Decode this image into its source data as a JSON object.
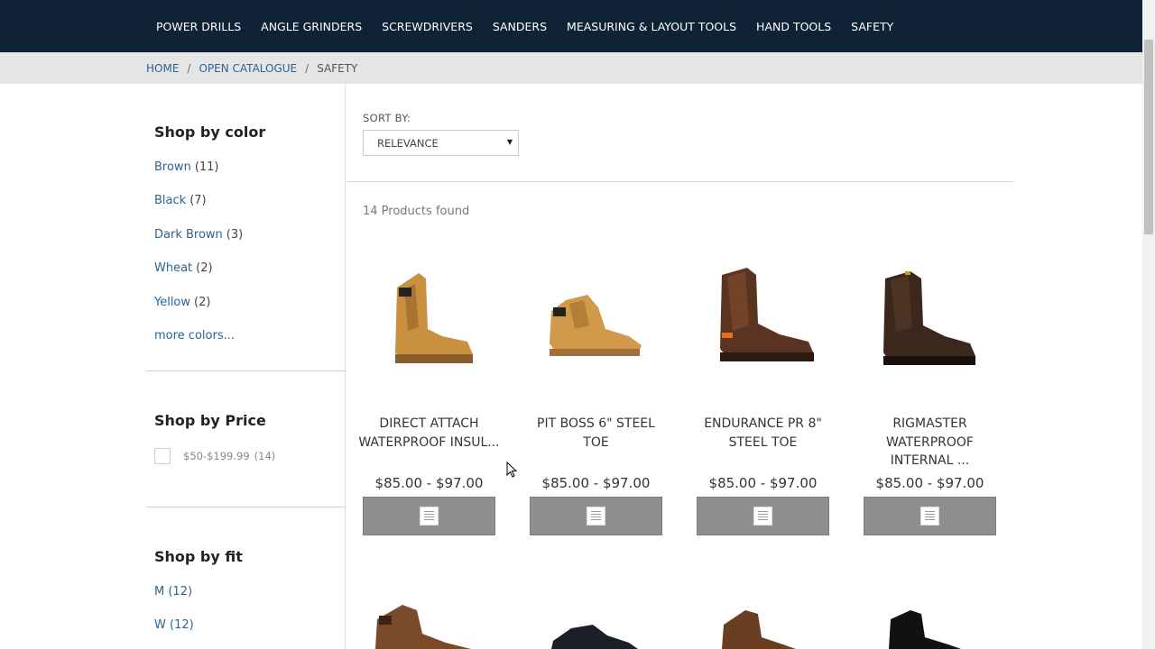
{
  "nav": [
    "POWER DRILLS",
    "ANGLE GRINDERS",
    "SCREWDRIVERS",
    "SANDERS",
    "MEASURING & LAYOUT TOOLS",
    "HAND TOOLS",
    "SAFETY"
  ],
  "breadcrumb": {
    "home": "HOME",
    "sep": "/",
    "catalogue": "OPEN CATALOGUE",
    "current": "SAFETY"
  },
  "filters": {
    "color": {
      "title": "Shop by color",
      "items": [
        {
          "label": "Brown",
          "count": "(11)"
        },
        {
          "label": "Black",
          "count": "(7)"
        },
        {
          "label": "Dark Brown",
          "count": "(3)"
        },
        {
          "label": "Wheat",
          "count": "(2)"
        },
        {
          "label": "Yellow",
          "count": "(2)"
        }
      ],
      "more": "more colors..."
    },
    "price": {
      "title": "Shop by Price",
      "option": "$50-$199.99",
      "count": "(14)"
    },
    "fit": {
      "title": "Shop by fit",
      "items": [
        {
          "label": "M",
          "count": "(12)"
        },
        {
          "label": "W",
          "count": "(12)"
        }
      ]
    }
  },
  "sort": {
    "label": "SORT BY:",
    "selected": "RELEVANCE"
  },
  "results": {
    "found": "14 Products found"
  },
  "products": [
    {
      "name": "DIRECT ATTACH WATERPROOF INSUL...",
      "price": "$85.00 - $97.00",
      "color": "#c8903f"
    },
    {
      "name": "PIT BOSS 6\" STEEL TOE",
      "price": "$85.00 - $97.00",
      "color": "#d09a4a"
    },
    {
      "name": "ENDURANCE PR 8\" STEEL TOE",
      "price": "$85.00 - $97.00",
      "color": "#5a3420"
    },
    {
      "name": "RIGMASTER WATERPROOF INTERNAL ...",
      "price": "$85.00 - $97.00",
      "color": "#3b271c"
    }
  ],
  "colors": {
    "nav_bg": "#0f2236",
    "link": "#2a6496",
    "button_bg": "#8f8f8f"
  }
}
